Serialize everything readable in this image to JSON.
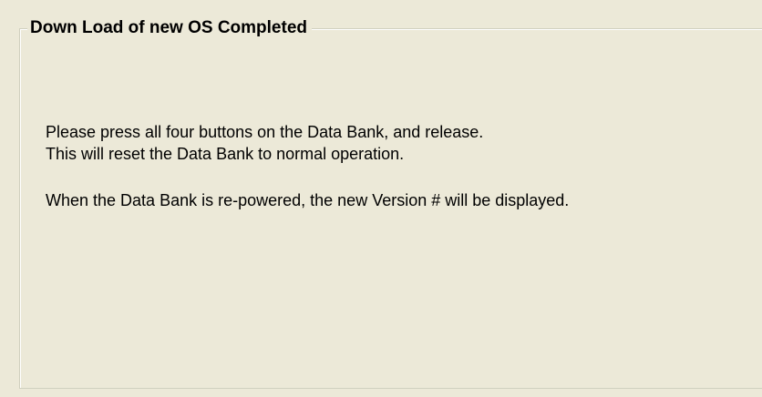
{
  "group": {
    "title": "Down Load of new OS Completed"
  },
  "message": {
    "line1": "Please press all four buttons on the Data Bank, and release.",
    "line2": "This will reset the Data Bank to normal operation.",
    "line3": "When the Data Bank is re-powered, the new Version # will be displayed."
  },
  "colors": {
    "background": "#ECE9D8",
    "border": "#D0D0BF",
    "text": "#000000"
  }
}
